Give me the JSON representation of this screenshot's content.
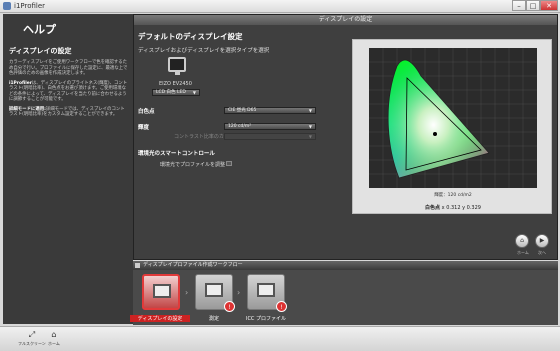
{
  "app": {
    "title": "i1Profiler"
  },
  "window": {
    "min": "–",
    "max": "□",
    "close": "✕"
  },
  "help": {
    "heading": "ヘルプ",
    "section_title": "ディスプレイの設定",
    "para1": "カラーディスプレイをご使用ワークフローで色を確認するため自分で行い。プロファイルに保存した設定に、最適な上で色評価のための画像を作成決定します。",
    "para2_bold": "i1Profiler",
    "para2": "は、ディスプレイのプライトネス(輝度)、コントラスト(明暗比率)、白色点をお選び頂けます。ご使用環境などの条件によって、ディスプレイを当たり前に合わせるように調節することが可能です。",
    "para3_bold": "詳細モードに適用:",
    "para3": "詳細モードでは、ディスプレイのコントラスト(明暗比率)をカスタム設定することができます。"
  },
  "main": {
    "header": "ディスプレイの設定",
    "section_title": "デフォルトのディスプレイ設定",
    "select_display_label": "ディスプレイおよびディスプレイを選択タイプを選択",
    "monitor_name": "EIZO EV2450",
    "display_type": "LCD 白色 LED",
    "whitepoint_label": "白色点",
    "whitepoint_value": "CIE 昼光 D65",
    "luminance_label": "輝度",
    "luminance_value": "120 cd/m²",
    "contrast_label": "コントラスト比率のカスタム",
    "contrast_value": "",
    "smart_control_label": "環境光のスマートコントロール",
    "profile_check_label": "環境光でプロファイルを調整",
    "luminance_readout": "輝度：120 cd/m2",
    "whitepoint_readout_label": "白色点",
    "whitepoint_readout_value": "x 0.312 y 0.329",
    "home_label": "ホーム",
    "next_label": "次へ"
  },
  "workflow": {
    "title": "ディスプレイプロファイル作成ワークフロー",
    "steps": [
      {
        "label": "ディスプレイの設定"
      },
      {
        "label": "測定"
      },
      {
        "label": "ICC プロファイル"
      }
    ]
  },
  "toolbar": {
    "fullscreen": "フルスクリーン",
    "home": "ホーム"
  },
  "colors": {
    "accent": "#d33333",
    "panel": "#3f3f3f"
  }
}
